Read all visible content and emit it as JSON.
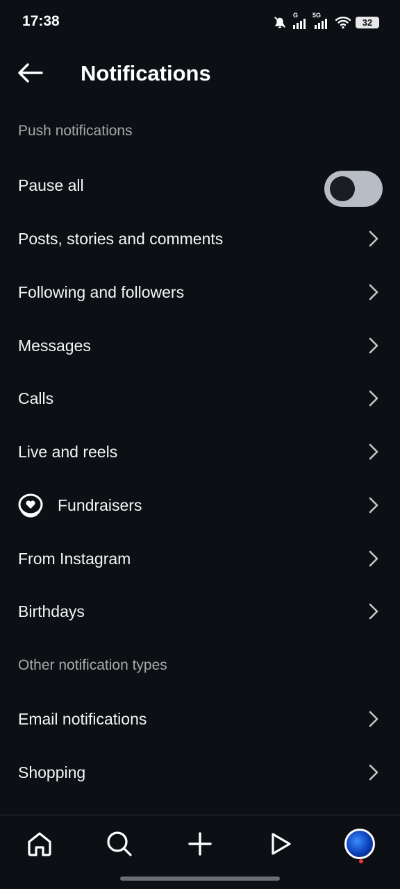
{
  "status_bar": {
    "time": "17:38",
    "network_1": "G",
    "network_2": "5G",
    "battery": "32",
    "icons": [
      "mute-bell-icon",
      "signal-icon",
      "signal-5g-icon",
      "wifi-icon",
      "battery-icon"
    ]
  },
  "header": {
    "title": "Notifications",
    "back_icon": "arrow-left-icon"
  },
  "sections": [
    {
      "title": "Push notifications",
      "items": [
        {
          "label": "Pause all",
          "control": "toggle",
          "toggle_on": false
        },
        {
          "label": "Posts, stories and comments",
          "control": "chevron"
        },
        {
          "label": "Following and followers",
          "control": "chevron"
        },
        {
          "label": "Messages",
          "control": "chevron"
        },
        {
          "label": "Calls",
          "control": "chevron"
        },
        {
          "label": "Live and reels",
          "control": "chevron"
        },
        {
          "label": "Fundraisers",
          "control": "chevron",
          "icon": "fundraiser-heart-icon"
        },
        {
          "label": "From Instagram",
          "control": "chevron"
        },
        {
          "label": "Birthdays",
          "control": "chevron"
        }
      ]
    },
    {
      "title": "Other notification types",
      "items": [
        {
          "label": "Email notifications",
          "control": "chevron"
        },
        {
          "label": "Shopping",
          "control": "chevron"
        }
      ]
    }
  ],
  "bottom_nav": {
    "items": [
      "home-icon",
      "search-icon",
      "create-plus-icon",
      "reels-play-icon",
      "profile-avatar"
    ]
  },
  "colors": {
    "background": "#0c1014",
    "text": "#f5f5f5",
    "secondary_text": "#a8a8a8",
    "toggle_off_track": "#b8bcc4",
    "notification_dot": "#ff3040"
  }
}
